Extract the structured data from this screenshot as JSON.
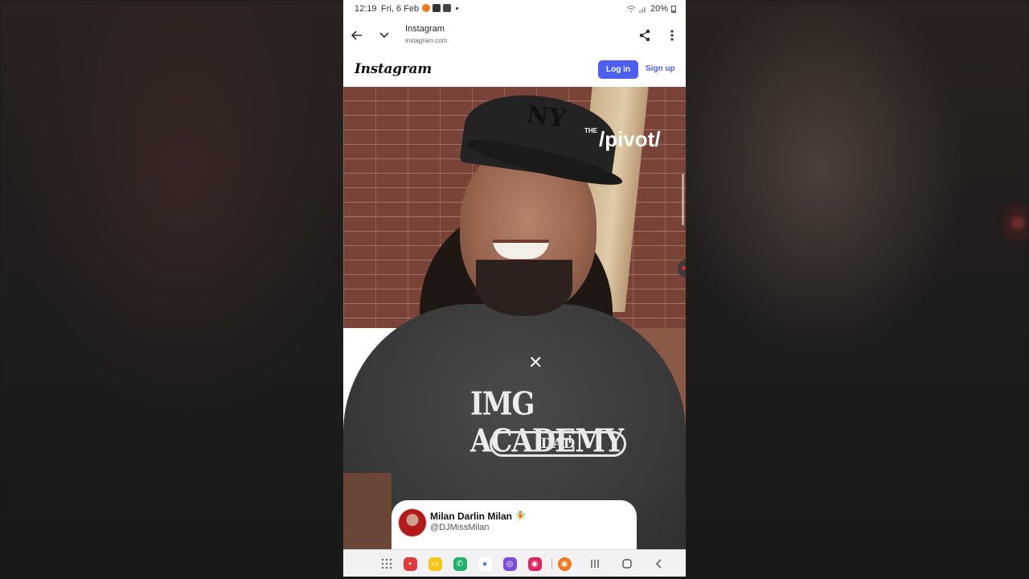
{
  "status_bar": {
    "time": "12:19",
    "date": "Fri, 6 Feb",
    "battery": "20%"
  },
  "browser": {
    "title": "Instagram",
    "url": "instagram.com"
  },
  "instagram": {
    "logo": "Instagram",
    "login_label": "Log in",
    "signup_label": "Sign up"
  },
  "video": {
    "watermark_prefix": "THE",
    "watermark": "/pivot/",
    "shirt_text": "IMG ACADEMY",
    "shirt_pill": "DAD"
  },
  "tweet": {
    "name": "Milan Darlin Milan",
    "emoji": "🧚",
    "handle": "@DJMissMilan"
  },
  "nav_bar": {
    "apps": [
      {
        "name": "app-drawer-icon",
        "color": "#666666"
      },
      {
        "name": "flipboard-icon",
        "color": "#e03a3a"
      },
      {
        "name": "notes-icon",
        "color": "#f7c518"
      },
      {
        "name": "phone-icon",
        "color": "#20b06a"
      },
      {
        "name": "messages-icon",
        "color": "#3a7be0"
      },
      {
        "name": "browser-icon",
        "color": "#7a4ce0"
      },
      {
        "name": "camera-icon",
        "color": "#e0245e"
      },
      {
        "name": "screen-recorder-icon",
        "color": "#f07a1a"
      }
    ]
  }
}
